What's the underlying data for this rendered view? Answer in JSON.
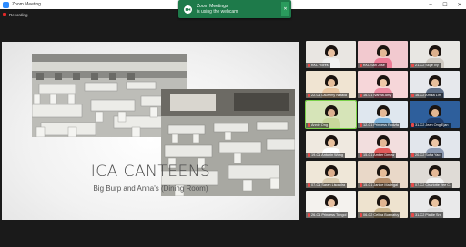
{
  "window": {
    "title": "Zoom Meeting",
    "controls": [
      "–",
      "☐",
      "✕"
    ]
  },
  "recording": {
    "label": "Recording"
  },
  "toast": {
    "line1": "Zoom Meetings",
    "line2": "is using the webcam"
  },
  "slide": {
    "title": "ICA CANTEENS",
    "subtitle": "Big Burp and Anna's (Dining Room)"
  },
  "colors": {
    "toast_bg": "#1e7a4a",
    "recording": "#e02828",
    "zoom_blue": "#2d8cff",
    "active_speaker": "#7ad14a"
  },
  "participants": [
    {
      "name": "KKL Flores",
      "bg": "#e9e6e2",
      "shirt": "#f1f1f1",
      "skin": "#e8c0a0"
    },
    {
      "name": "KKL San Jose",
      "bg": "#f2c9cf",
      "shirt": "#ef7b96",
      "skin": "#e4b896"
    },
    {
      "name": "21-C2 Skye Ivy",
      "bg": "#e8e7e3",
      "shirt": "#cfcac2",
      "skin": "#dcb08c"
    },
    {
      "name": "22-C1 Lauremy Natalia",
      "bg": "#f0e4d2",
      "shirt": "#e9c6a2",
      "skin": "#e6be9a"
    },
    {
      "name": "16-C1 Ivanna Amy",
      "bg": "#f6d6d9",
      "shirt": "#ec8aa0",
      "skin": "#f0c8a8"
    },
    {
      "name": "16-C2 Amika Lim",
      "bg": "#e6e8ec",
      "shirt": "#5f6f86",
      "skin": "#e6bf9c"
    },
    {
      "name": "Annie Ong",
      "bg": "#d6e4b8",
      "shirt": "#c8d79b",
      "skin": "#dcb090"
    },
    {
      "name": "12-C1 Princess Rodzfa",
      "bg": "#dfe7ef",
      "shirt": "#7db2da",
      "skin": "#e4b896"
    },
    {
      "name": "31-C2 Jean Ong Ejan",
      "bg": "#2e5f9c",
      "shirt": "#1f3d6b",
      "skin": "#e2b792"
    },
    {
      "name": "19-C1 Antonin Wong",
      "bg": "#efe9e0",
      "shirt": "#ffffff",
      "skin": "#e8c09c"
    },
    {
      "name": "15-C1 Amber Dmow",
      "bg": "#f2dede",
      "shirt": "#e25a5a",
      "skin": "#e4b896"
    },
    {
      "name": "20-C2 Sofia Yao",
      "bg": "#e2e6ec",
      "shirt": "#8a98b0",
      "skin": "#ecc6a6"
    },
    {
      "name": "07-C1 Sarah Lisondra",
      "bg": "#efe7d8",
      "shirt": "#d9cbb0",
      "skin": "#dcae8c"
    },
    {
      "name": "15-C1 Janice Madrigal",
      "bg": "#e9d8c8",
      "shirt": "#b68e6b",
      "skin": "#e6bc98"
    },
    {
      "name": "07-C2 Charlotte Yee C.",
      "bg": "#dfdbd6",
      "shirt": "#f3f3f3",
      "skin": "#e4b896"
    },
    {
      "name": "26-C1 Princess Tungol",
      "bg": "#f4f2ee",
      "shirt": "#ffffff",
      "skin": "#e8c0a0"
    },
    {
      "name": "06-C2 Celina Buenafuy",
      "bg": "#eee3cf",
      "shirt": "#c9b38b",
      "skin": "#e0b490"
    },
    {
      "name": "31-C2 Pladie Snt",
      "bg": "#e9e9ea",
      "shirt": "#dcdcdc",
      "skin": "#e8c2a0"
    }
  ]
}
